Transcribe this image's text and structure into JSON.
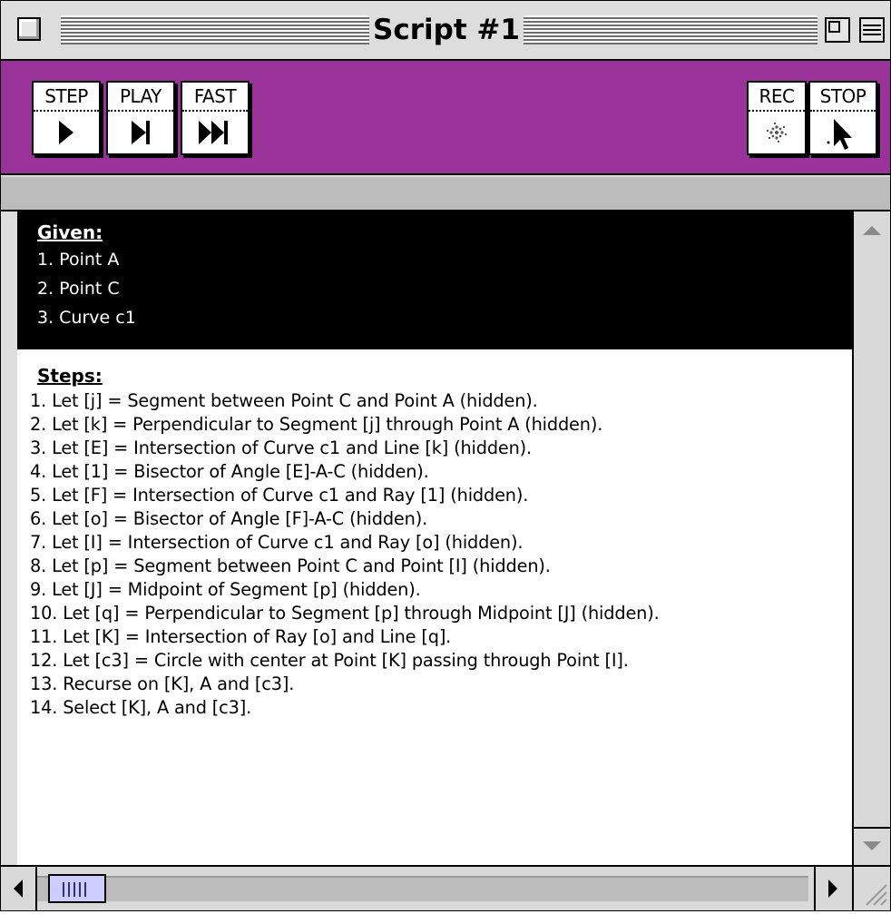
{
  "window": {
    "title": "Script #1"
  },
  "toolbar": {
    "step_label": "STEP",
    "play_label": "PLAY",
    "fast_label": "FAST",
    "rec_label": "REC",
    "stop_label": "STOP",
    "background_color": "#993399"
  },
  "given": {
    "header": "Given:",
    "items": [
      "1. Point A",
      "2. Point C",
      "3. Curve c1"
    ]
  },
  "steps": {
    "header": "Steps:",
    "items": [
      "1. Let [j] = Segment between Point C and Point A (hidden).",
      "2. Let [k] = Perpendicular to Segment [j] through Point A (hidden).",
      "3. Let [E] = Intersection of Curve c1 and Line [k] (hidden).",
      "4. Let [1] = Bisector of Angle [E]-A-C (hidden).",
      "5. Let [F] = Intersection of Curve c1 and Ray [1] (hidden).",
      "6. Let [o] = Bisector of Angle [F]-A-C (hidden).",
      "7. Let [I] = Intersection of Curve c1 and Ray [o] (hidden).",
      "8. Let [p] = Segment between Point C and Point [I] (hidden).",
      "9. Let [J] = Midpoint of Segment [p] (hidden).",
      "10. Let [q] = Perpendicular to Segment [p] through Midpoint [J] (hidden).",
      "11. Let [K] = Intersection of Ray [o] and Line [q].",
      "12. Let [c3] = Circle with center at Point [K] passing through Point [I].",
      "13. Recurse on [K], A and [c3].",
      "14. Select [K], A and [c3]."
    ]
  },
  "icons": {
    "step": "step-play-triangle-icon",
    "play": "play-to-bar-icon",
    "fast": "fast-forward-icon",
    "rec": "record-dots-icon",
    "stop": "arrow-cursor-icon"
  }
}
